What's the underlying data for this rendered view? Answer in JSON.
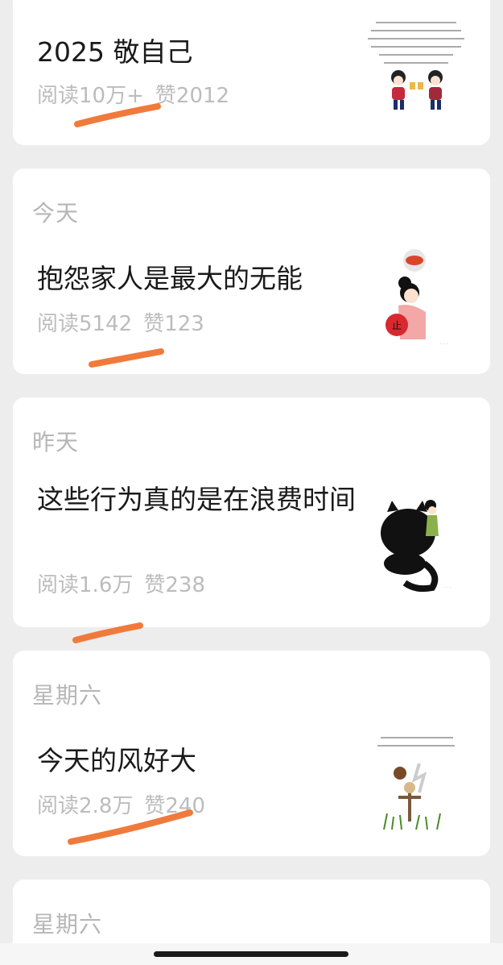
{
  "articles": [
    {
      "date": "",
      "title": "2025  敬自己",
      "reads_label": "阅读",
      "reads": "10万+",
      "likes_label": "赞",
      "likes": "2012",
      "thumbnail_icon": "cartoon-toast-icon"
    },
    {
      "date": "今天",
      "title": "抱怨家人是最大的无能",
      "reads_label": "阅读",
      "reads": "5142",
      "likes_label": "赞",
      "likes": "123",
      "thumbnail_icon": "cartoon-girl-fan-icon"
    },
    {
      "date": "昨天",
      "title": "这些行为真的是在浪费时间",
      "reads_label": "阅读",
      "reads": "1.6万",
      "likes_label": "赞",
      "likes": "238",
      "thumbnail_icon": "cartoon-black-cat-icon"
    },
    {
      "date": "星期六",
      "title": "今天的风好大",
      "reads_label": "阅读",
      "reads": "2.8万",
      "likes_label": "赞",
      "likes": "240",
      "thumbnail_icon": "cartoon-scarecrow-icon"
    },
    {
      "date": "星期六"
    }
  ],
  "colors": {
    "background": "#ededed",
    "card": "#ffffff",
    "highlight_stroke": "#f07a3c",
    "muted_text": "#bcbcbc",
    "title_text": "#1a1a1a"
  }
}
